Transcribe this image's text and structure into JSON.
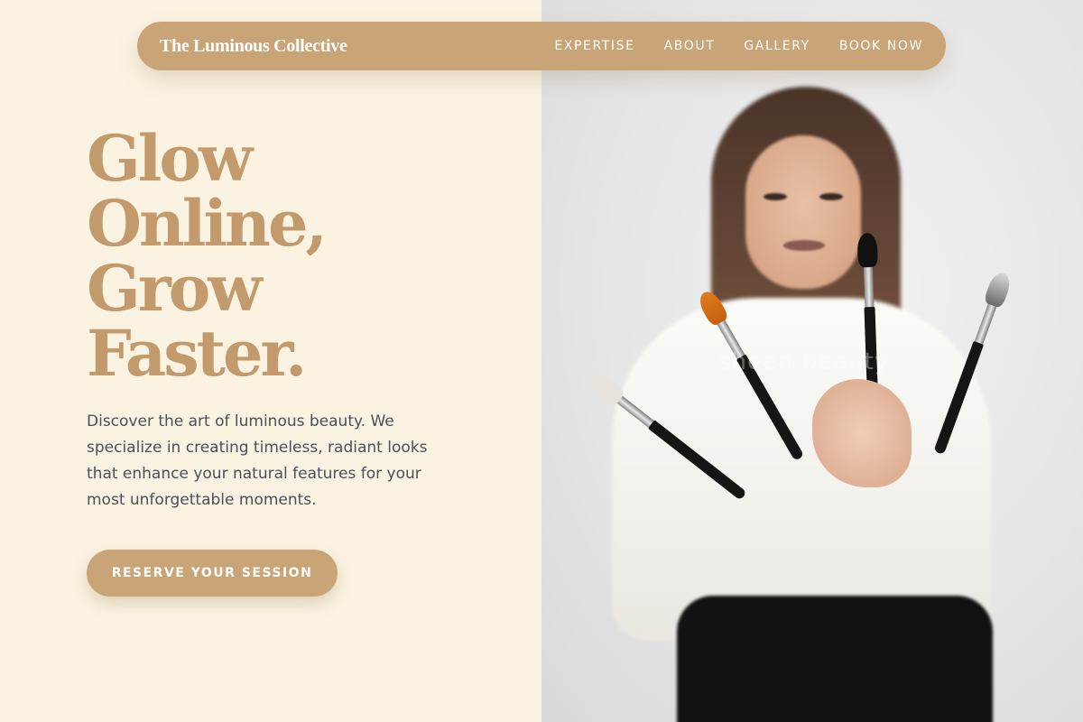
{
  "brand": {
    "name": "The Luminous Collective"
  },
  "nav": {
    "items": [
      {
        "label": "EXPERTISE"
      },
      {
        "label": "ABOUT"
      },
      {
        "label": "GALLERY"
      },
      {
        "label": "BOOK NOW"
      }
    ]
  },
  "hero": {
    "headline_lines": [
      "Glow",
      "Online,",
      "Grow",
      "Faster."
    ],
    "description": "Discover the art of luminous beauty. We specialize in creating timeless, radiant looks that enhance your natural features for your most unforgettable moments.",
    "cta_label": "RESERVE YOUR SESSION",
    "image_watermark": "sheen beauty"
  },
  "colors": {
    "background": "#fbf3e2",
    "accent": "#c9a477",
    "headline": "#c39a6b",
    "body_text": "#4a4f5a"
  }
}
